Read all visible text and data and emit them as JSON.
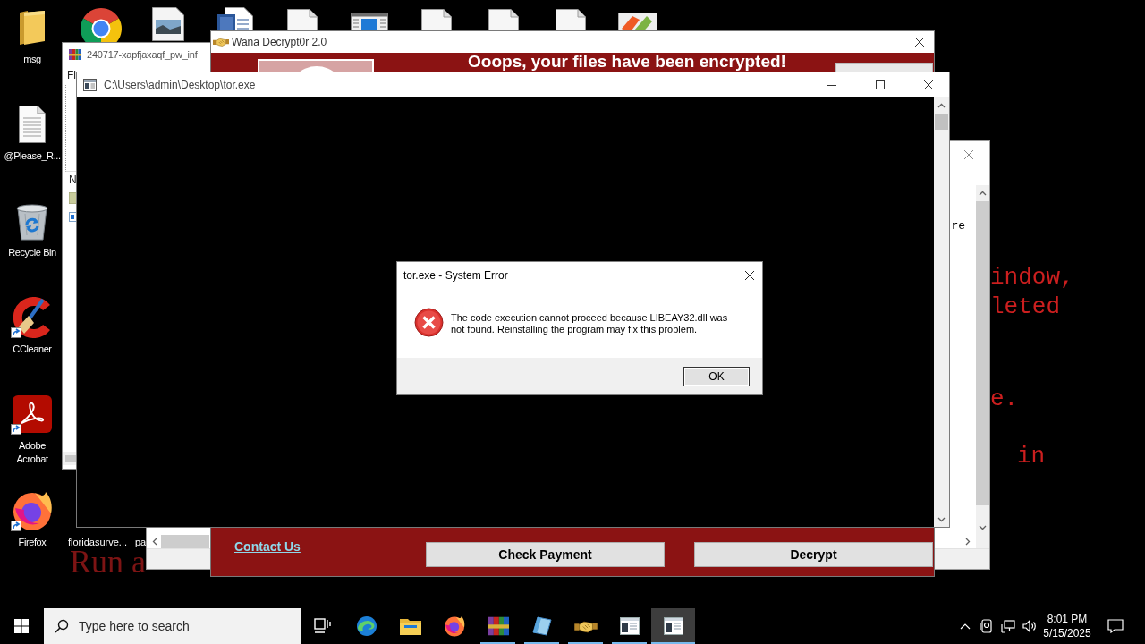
{
  "desktop": {
    "icons": [
      {
        "label": "msg",
        "kind": "folder",
        "shortcut": false
      },
      {
        "label": "@Please_R...",
        "kind": "text-file",
        "shortcut": false
      },
      {
        "label": "Recycle Bin",
        "kind": "recycle-bin",
        "shortcut": false
      },
      {
        "label": "CCleaner",
        "kind": "cleaner",
        "shortcut": true
      },
      {
        "label": "Adobe Acrobat",
        "kind": "pdf-reader",
        "shortcut": true
      },
      {
        "label": "Firefox",
        "kind": "firefox",
        "shortcut": true
      }
    ],
    "top_row": [
      {
        "kind": "chrome"
      },
      {
        "kind": "image-file"
      },
      {
        "kind": "word-file"
      },
      {
        "kind": "blank-file"
      },
      {
        "kind": "window-file"
      },
      {
        "kind": "blank-file"
      },
      {
        "kind": "blank-file"
      },
      {
        "kind": "blank-file"
      },
      {
        "kind": "picture-file"
      }
    ],
    "bottom_row": [
      {
        "label": "floridasurve..."
      },
      {
        "label": "pa"
      }
    ],
    "wallpaper_text": [
      "indow,",
      "leted",
      "e.",
      "in",
      "Run a"
    ]
  },
  "archive_window": {
    "title": "240717-xapfjaxaqf_pw_inf",
    "menu": [
      "Fi"
    ],
    "column_header": "N"
  },
  "text_window": {
    "text": "re"
  },
  "decryptor_window": {
    "title": "Wana Decrypt0r 2.0",
    "heading": "Ooops, your files have been encrypted!",
    "contact_link": "Contact Us",
    "buttons": [
      "Check Payment",
      "Decrypt"
    ]
  },
  "console_window": {
    "title": "C:\\Users\\admin\\Desktop\\tor.exe"
  },
  "error_dialog": {
    "title": "tor.exe - System Error",
    "message": "The code execution cannot proceed because LIBEAY32.dll was not found. Reinstalling the program may fix this problem.",
    "buttons": [
      "OK"
    ]
  },
  "taskbar": {
    "search": {
      "placeholder": "Type here to search"
    },
    "apps": [
      {
        "kind": "edge",
        "running": false,
        "active": false
      },
      {
        "kind": "explorer",
        "running": false,
        "active": false
      },
      {
        "kind": "firefox",
        "running": false,
        "active": false
      },
      {
        "kind": "archiver",
        "running": true,
        "active": false
      },
      {
        "kind": "editor",
        "running": true,
        "active": false
      },
      {
        "kind": "decryptor",
        "running": true,
        "active": false
      },
      {
        "kind": "console",
        "running": true,
        "active": false
      },
      {
        "kind": "console",
        "running": true,
        "active": true
      }
    ],
    "clock": {
      "time": "8:01 PM",
      "date": "5/15/2025"
    }
  }
}
